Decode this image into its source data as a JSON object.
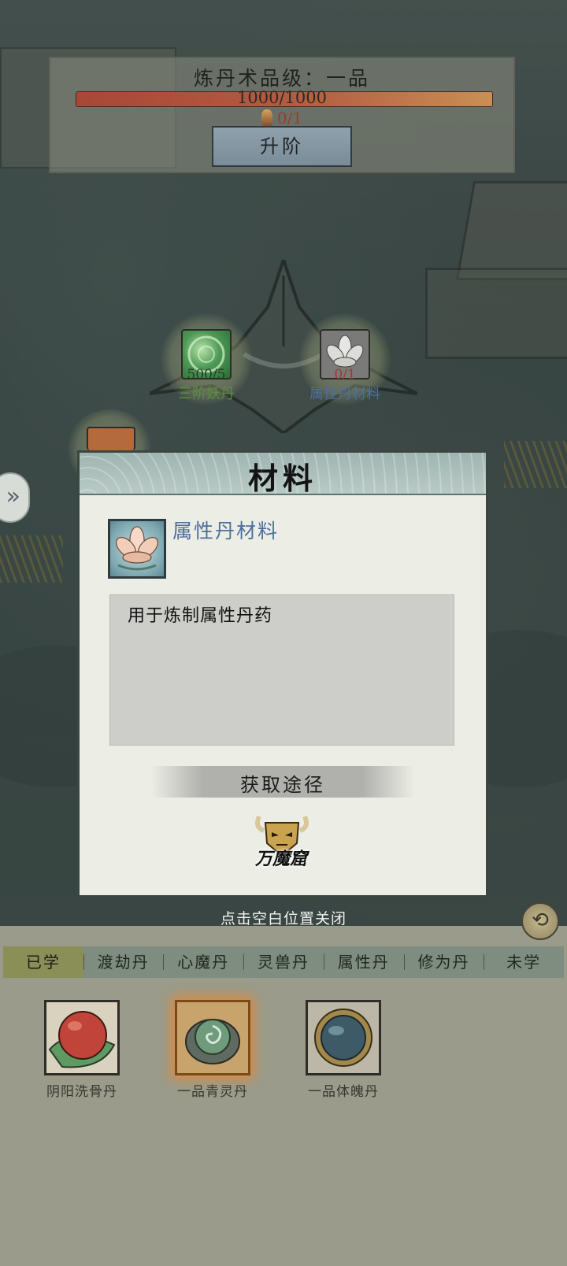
{
  "level_panel": {
    "title": "炼丹术品级：一品",
    "exp_text": "1000/1000",
    "exp_progress": 1.0,
    "stone_count": "0/1",
    "upgrade_label": "升阶"
  },
  "nodes": [
    {
      "count": "500/5",
      "label": "三阶妖丹",
      "label_color": "#5a8f3c",
      "icon": "green-orb-icon"
    },
    {
      "count": "0/1",
      "label": "属性丹材料",
      "label_color": "#4d6f9c",
      "icon": "lotus-icon"
    }
  ],
  "modal": {
    "title": "材料",
    "item_name": "属性丹材料",
    "item_icon": "lotus-icon",
    "description": "用于炼制属性丹药",
    "source_title": "获取途径",
    "source_name": "万魔窟",
    "source_icon": "demon-mask-icon"
  },
  "close_hint": "点击空白位置关闭",
  "tabs": [
    {
      "label": "已学",
      "active": true
    },
    {
      "label": "渡劫丹",
      "active": false
    },
    {
      "label": "心魔丹",
      "active": false
    },
    {
      "label": "灵兽丹",
      "active": false
    },
    {
      "label": "属性丹",
      "active": false
    },
    {
      "label": "修为丹",
      "active": false
    },
    {
      "label": "未学",
      "active": false
    }
  ],
  "pills": [
    {
      "label": "阴阳洗骨丹",
      "icon": "red-pill-icon",
      "selected": false
    },
    {
      "label": "一品青灵丹",
      "icon": "green-swirl-pill-icon",
      "selected": true
    },
    {
      "label": "一品体魄丹",
      "icon": "blue-pill-icon",
      "selected": false
    }
  ],
  "colors": {
    "accent_blue": "#4e6f9a",
    "exp_bar": "#a84737",
    "stone_text": "#9c3b2e",
    "tab_active": "#8a8f58"
  }
}
